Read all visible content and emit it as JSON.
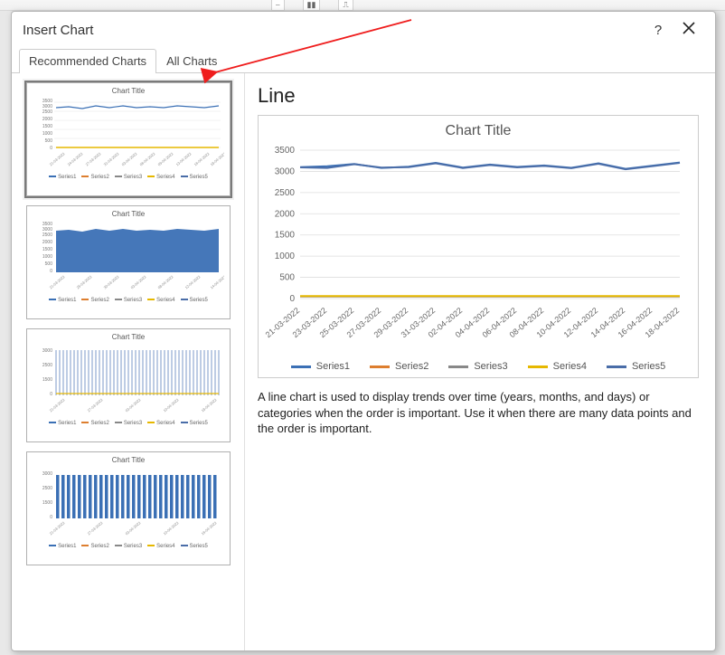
{
  "dialog": {
    "title": "Insert Chart",
    "help": "?",
    "close": "×"
  },
  "tabs": {
    "recommended": "Recommended Charts",
    "all": "All Charts"
  },
  "preview": {
    "type_title": "Line",
    "chart_title": "Chart Title",
    "description": "A line chart is used to display trends over time (years, months, and days) or categories when the order is important. Use it when there are many data points and the order is important."
  },
  "thumbnails": [
    {
      "title": "Chart Title",
      "kind": "line"
    },
    {
      "title": "Chart Title",
      "kind": "area"
    },
    {
      "title": "Chart Title",
      "kind": "grid"
    },
    {
      "title": "Chart Title",
      "kind": "columns"
    }
  ],
  "legend": {
    "s1": "Series1",
    "s2": "Series2",
    "s3": "Series3",
    "s4": "Series4",
    "s5": "Series5"
  },
  "colors": {
    "s1": "#3b70b5",
    "s2": "#dd7e2f",
    "s3": "#888888",
    "s4": "#e6b800",
    "s5": "#4a6da8",
    "areafill": "#3b70b5",
    "axis": "#bfbfbf",
    "gridline": "#dedede",
    "arrow": "#ef1d1d"
  },
  "chart_data": {
    "type": "line",
    "title": "Chart Title",
    "xlabel": "",
    "ylabel": "",
    "ylim": [
      0,
      3500
    ],
    "y_ticks": [
      0,
      500,
      1000,
      1500,
      2000,
      2500,
      3000,
      3500
    ],
    "categories": [
      "21-03-2022",
      "23-03-2022",
      "25-03-2022",
      "27-03-2022",
      "29-03-2022",
      "31-03-2022",
      "02-04-2022",
      "04-04-2022",
      "06-04-2022",
      "08-04-2022",
      "10-04-2022",
      "12-04-2022",
      "14-04-2022",
      "16-04-2022",
      "18-04-2022"
    ],
    "series": [
      {
        "name": "Series1",
        "color": "#3b70b5",
        "values": [
          3100,
          3120,
          3175,
          3080,
          3110,
          3200,
          3090,
          3160,
          3105,
          3140,
          3085,
          3190,
          3060,
          3135,
          3210
        ]
      },
      {
        "name": "Series2",
        "color": "#dd7e2f",
        "values": [
          50,
          50,
          50,
          50,
          50,
          50,
          50,
          50,
          50,
          50,
          50,
          50,
          50,
          50,
          50
        ]
      },
      {
        "name": "Series3",
        "color": "#888888",
        "values": [
          50,
          50,
          50,
          50,
          50,
          50,
          50,
          50,
          50,
          50,
          50,
          50,
          50,
          50,
          50
        ]
      },
      {
        "name": "Series4",
        "color": "#e6b800",
        "values": [
          60,
          60,
          60,
          60,
          60,
          60,
          60,
          60,
          60,
          60,
          60,
          60,
          60,
          60,
          60
        ]
      },
      {
        "name": "Series5",
        "color": "#4a6da8",
        "values": [
          3095,
          3080,
          3170,
          3090,
          3100,
          3190,
          3080,
          3150,
          3095,
          3130,
          3075,
          3180,
          3050,
          3125,
          3200
        ]
      }
    ]
  }
}
